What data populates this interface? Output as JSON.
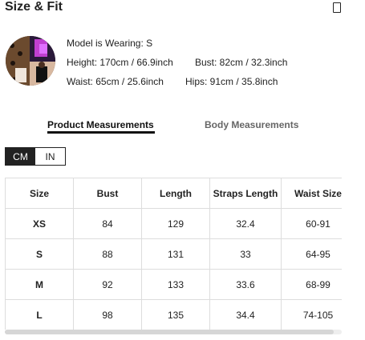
{
  "header": {
    "title": "Size & Fit",
    "close_icon": "close-icon"
  },
  "model": {
    "wearing": "Model is Wearing: S",
    "height": "Height: 170cm / 66.9inch",
    "bust": "Bust: 82cm / 32.3inch",
    "waist": "Waist: 65cm / 25.6inch",
    "hips": "Hips: 91cm / 35.8inch"
  },
  "tabs": [
    {
      "label": "Product Measurements",
      "active": true
    },
    {
      "label": "Body Measurements",
      "active": false
    }
  ],
  "units": {
    "options": [
      "CM",
      "IN"
    ],
    "selected": "CM"
  },
  "table": {
    "headers": [
      "Size",
      "Bust",
      "Length",
      "Straps Length",
      "Waist Size"
    ],
    "rows": [
      [
        "XS",
        "84",
        "129",
        "32.4",
        "60-91"
      ],
      [
        "S",
        "88",
        "131",
        "33",
        "64-95"
      ],
      [
        "M",
        "92",
        "133",
        "33.6",
        "68-99"
      ],
      [
        "L",
        "98",
        "135",
        "34.4",
        "74-105"
      ]
    ]
  },
  "colors": {
    "accent": "#222222",
    "border": "#dddddd",
    "inactive_tab": "#666666"
  }
}
